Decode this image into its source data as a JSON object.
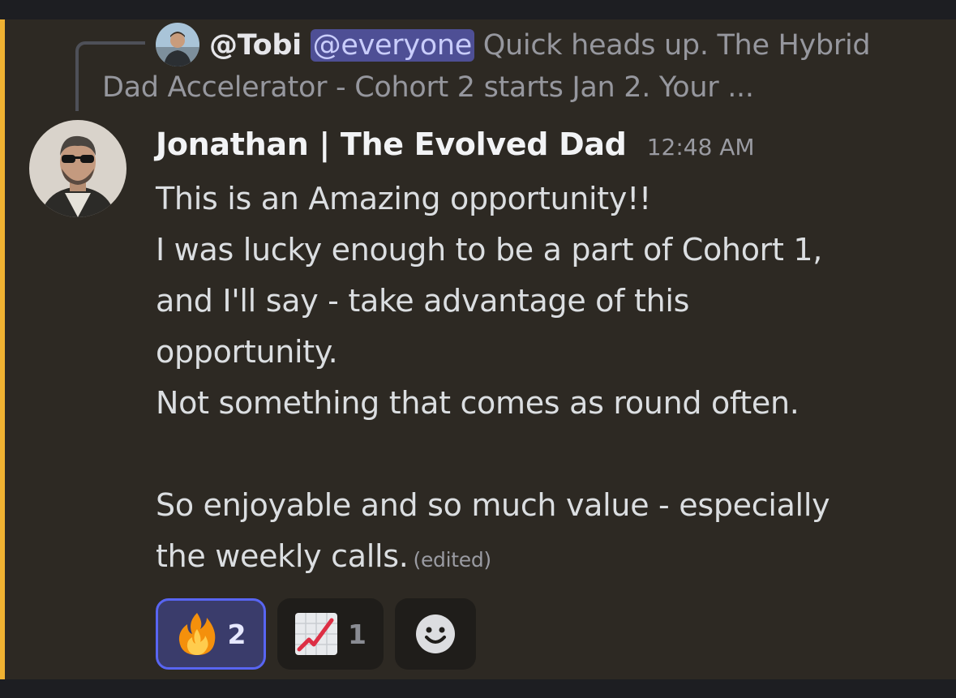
{
  "reply": {
    "author": "@Tobi",
    "mention": "@everyone",
    "text_line1": "Quick heads up.  The Hybrid",
    "text_line2": "Dad Accelerator - Cohort 2 starts Jan 2.   Your ..."
  },
  "message": {
    "author": "Jonathan | The Evolved Dad",
    "timestamp": "12:48 AM",
    "lines": [
      "This is an Amazing opportunity!!",
      "I was lucky enough to be a part of  Cohort 1,",
      "and I'll say - take advantage of this",
      "opportunity.",
      "Not something that comes as round often.",
      "",
      "So enjoyable and so much value - especially",
      "the weekly calls."
    ],
    "edited_label": "(edited)"
  },
  "reactions": [
    {
      "emoji": "fire-emoji",
      "count": "2",
      "active": true
    },
    {
      "emoji": "chart-increasing-emoji",
      "count": "1",
      "active": false
    }
  ],
  "add_reaction": {
    "icon": "smiley-add-icon"
  },
  "colors": {
    "accent_bar": "#f0b232",
    "mention_bg": "#4e4f95",
    "active_reaction_border": "#5865f2"
  }
}
